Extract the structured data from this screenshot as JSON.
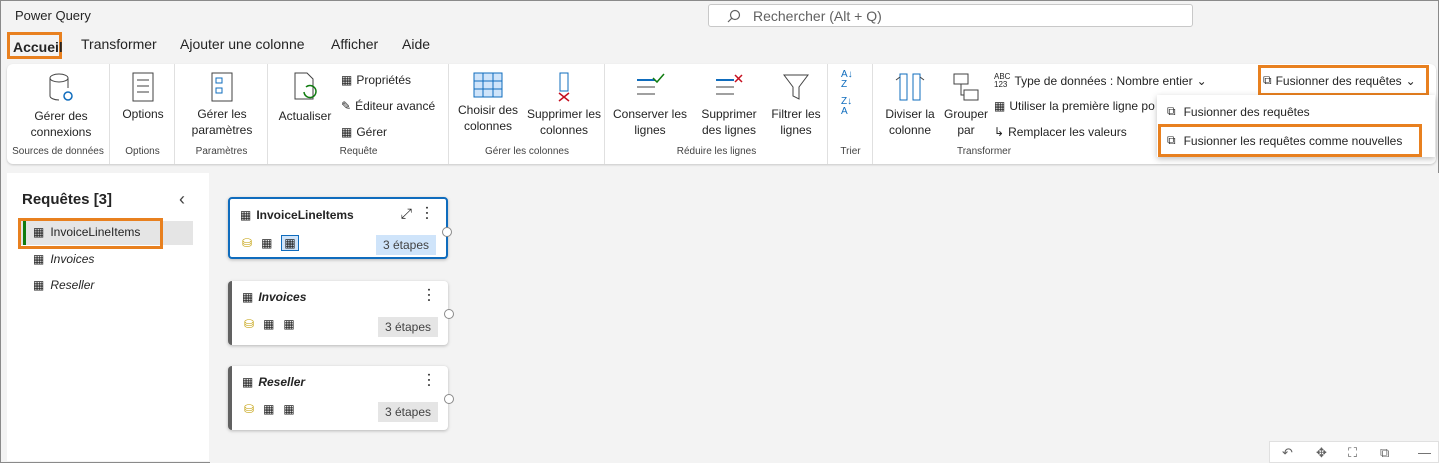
{
  "app": {
    "title": "Power Query"
  },
  "search": {
    "placeholder": "Rechercher (Alt + Q)"
  },
  "tabs": [
    "Accueil",
    "Transformer",
    "Ajouter une colonne",
    "Afficher",
    "Aide"
  ],
  "ribbon": {
    "groups": {
      "sources": "Sources de données",
      "options": "Options",
      "params": "Paramètres",
      "requete": "Requête",
      "gerer_colonnes": "Gérer les colonnes",
      "reduire": "Réduire les lignes",
      "trier": "Trier",
      "transformer": "Transformer"
    },
    "buttons": {
      "gerer_connexions": "Gérer des connexions",
      "options": "Options",
      "gerer_params": "Gérer les paramètres",
      "actualiser": "Actualiser",
      "proprietes": "Propriétés",
      "editeur": "Éditeur avancé",
      "gerer": "Gérer",
      "choisir_colonnes": "Choisir des colonnes",
      "supprimer_colonnes": "Supprimer les colonnes",
      "conserver_lignes": "Conserver les lignes",
      "supprimer_lignes": "Supprimer des lignes",
      "filtrer_lignes": "Filtrer les lignes",
      "diviser": "Diviser la colonne",
      "grouper": "Grouper par",
      "type_donnees": "Type de données : Nombre entier",
      "premiere_ligne": "Utiliser la première ligne po",
      "remplacer": "Remplacer les valeurs",
      "fusionner": "Fusionner des requêtes"
    }
  },
  "dropdown": {
    "items": [
      "Fusionner des requêtes",
      "Fusionner les requêtes comme nouvelles"
    ]
  },
  "queries_panel": {
    "title": "Requêtes [3]",
    "items": [
      "InvoiceLineItems",
      "Invoices",
      "Reseller"
    ]
  },
  "cards": [
    {
      "name": "InvoiceLineItems",
      "steps": "3 étapes"
    },
    {
      "name": "Invoices",
      "steps": "3 étapes"
    },
    {
      "name": "Reseller",
      "steps": "3 étapes"
    }
  ],
  "colors": {
    "accent": "#e8801f",
    "selected": "#0f6cbd",
    "steps_selected": "#cfe4fa"
  }
}
